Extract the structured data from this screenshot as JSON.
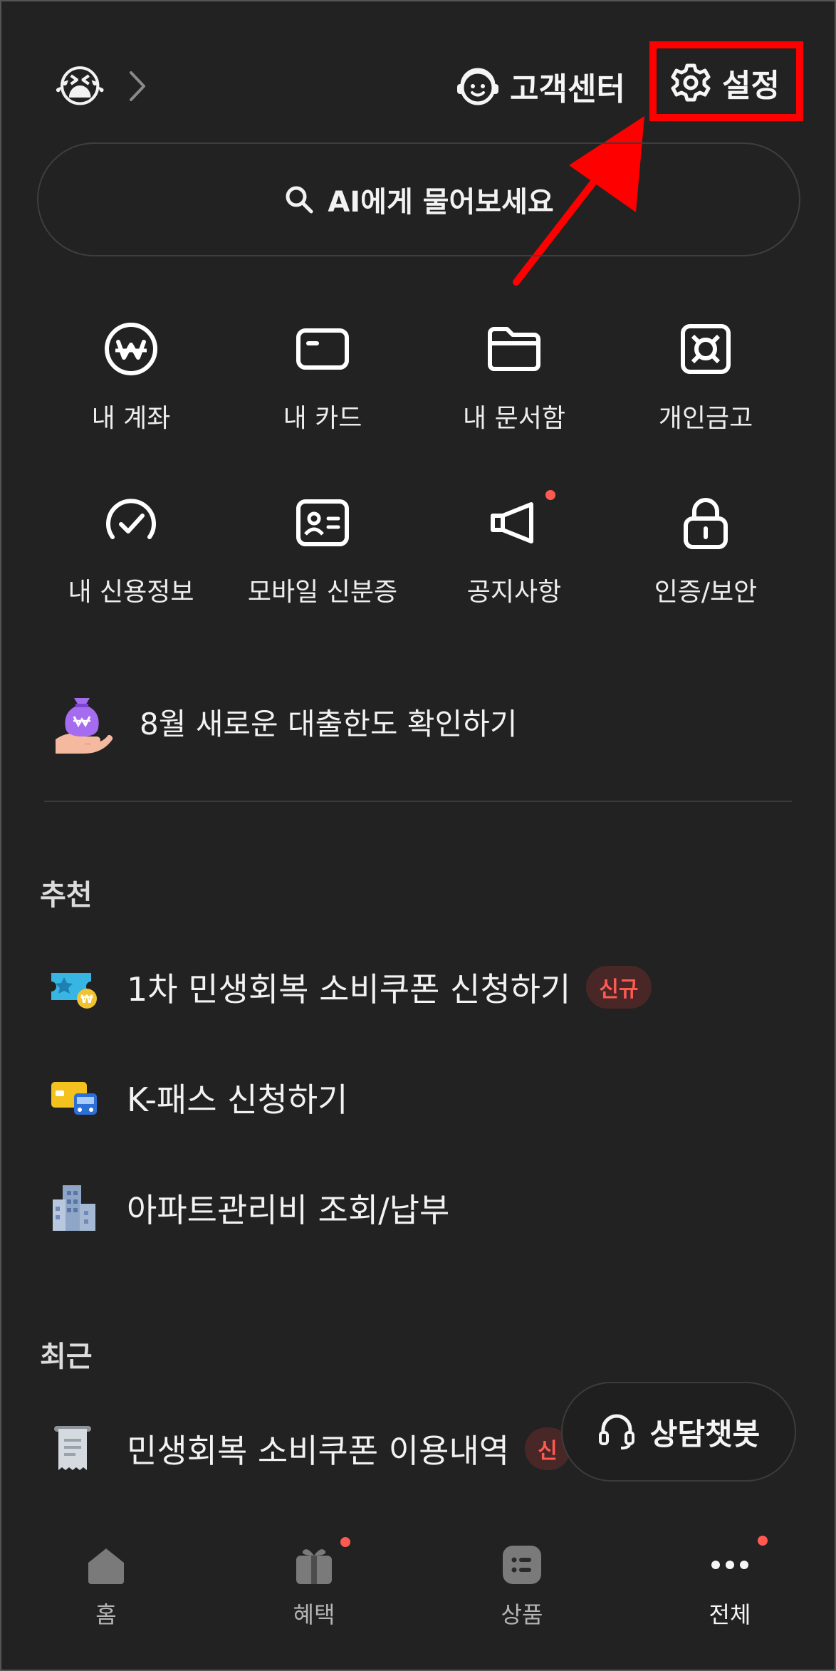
{
  "header": {
    "avatar_emoji": "😭",
    "support_label": "고객센터",
    "settings_label": "설정",
    "highlight_color": "#ff0000"
  },
  "search": {
    "placeholder": "AI에게 물어보세요",
    "icon": "search-icon"
  },
  "grid": [
    {
      "label": "내 계좌",
      "icon": "won-circle-icon"
    },
    {
      "label": "내 카드",
      "icon": "card-icon"
    },
    {
      "label": "내 문서함",
      "icon": "folder-icon"
    },
    {
      "label": "개인금고",
      "icon": "safe-icon"
    },
    {
      "label": "내 신용정보",
      "icon": "credit-check-icon"
    },
    {
      "label": "모바일 신분증",
      "icon": "id-card-icon"
    },
    {
      "label": "공지사항",
      "icon": "megaphone-icon",
      "has_new_dot": true
    },
    {
      "label": "인증/보안",
      "icon": "lock-icon"
    }
  ],
  "banner": {
    "text": "8월 새로운 대출한도 확인하기",
    "icon": "money-bag-icon"
  },
  "recommend": {
    "title": "추천",
    "items": [
      {
        "label": "1차 민생회복 소비쿠폰 신청하기",
        "badge": "신규",
        "icon": "coupon-icon"
      },
      {
        "label": "K-패스 신청하기",
        "icon": "transit-card-icon"
      },
      {
        "label": "아파트관리비 조회/납부",
        "icon": "apartment-icon"
      }
    ]
  },
  "recent": {
    "title": "최근",
    "items": [
      {
        "label": "민생회복 소비쿠폰 이용내역",
        "badge": "신",
        "icon": "receipt-icon"
      }
    ]
  },
  "chatbot": {
    "label": "상담챗봇",
    "icon": "headset-icon"
  },
  "bottom_nav": [
    {
      "label": "홈",
      "icon": "home-icon"
    },
    {
      "label": "혜택",
      "icon": "gift-icon",
      "has_new_dot": true
    },
    {
      "label": "상품",
      "icon": "list-icon"
    },
    {
      "label": "전체",
      "icon": "more-icon",
      "has_new_dot": true,
      "active": true
    }
  ],
  "colors": {
    "background": "#222222",
    "accent_dot": "#ff5a52",
    "badge_bg": "#4a2727"
  }
}
